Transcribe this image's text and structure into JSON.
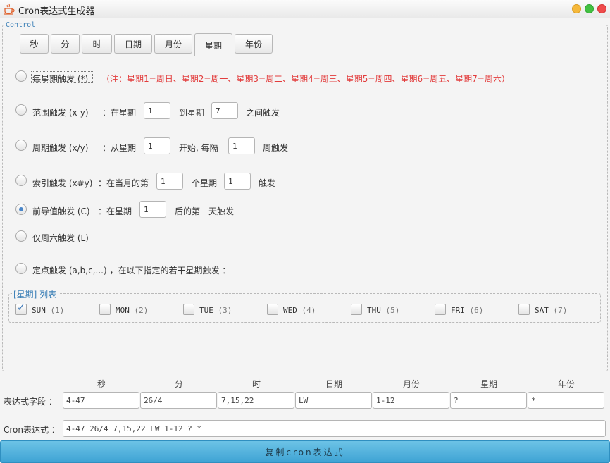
{
  "window": {
    "title": "Cron表达式生成器"
  },
  "control": {
    "legend": "Control"
  },
  "tabs": [
    {
      "label": "秒"
    },
    {
      "label": "分"
    },
    {
      "label": "时"
    },
    {
      "label": "日期"
    },
    {
      "label": "月份"
    },
    {
      "label": "星期",
      "active": true
    },
    {
      "label": "年份"
    }
  ],
  "options": {
    "every": {
      "label": "每星期触发 (*)",
      "note": "（注：星期1=周日、星期2=周一、星期3=周二、星期4=周三、星期5=周四、星期6=周五、星期7=周六）"
    },
    "range": {
      "label": "范围触发 (x-y)",
      "text1": "：在星期",
      "from": "1",
      "text2": "到星期",
      "to": "7",
      "text3": "之间触发"
    },
    "cycle": {
      "label": "周期触发 (x/y)",
      "text1": "：从星期",
      "start": "1",
      "text2": "开始, 每隔",
      "interval": "1",
      "text3": "周触发"
    },
    "index": {
      "label": "索引触发 (x#y)",
      "text1": "：在当月的第",
      "week": "1",
      "text2": "个星期",
      "day": "1",
      "text3": "触发"
    },
    "last": {
      "label": "前导值触发 (C)",
      "text1": "：在星期",
      "value": "1",
      "text2": "后的第一天触发",
      "selected": true
    },
    "sat": {
      "label": "仅周六触发 (L)"
    },
    "fixed": {
      "label": "定点触发 (a,b,c,...) ，在以下指定的若干星期触发 ："
    }
  },
  "weekdays": {
    "legend": "[星期] 列表",
    "items": [
      {
        "code": "SUN",
        "num": "(1)",
        "checked": true
      },
      {
        "code": "MON",
        "num": "(2)",
        "checked": false
      },
      {
        "code": "TUE",
        "num": "(3)",
        "checked": false
      },
      {
        "code": "WED",
        "num": "(4)",
        "checked": false
      },
      {
        "code": "THU",
        "num": "(5)",
        "checked": false
      },
      {
        "code": "FRI",
        "num": "(6)",
        "checked": false
      },
      {
        "code": "SAT",
        "num": "(7)",
        "checked": false
      }
    ]
  },
  "fields": {
    "headers": [
      "秒",
      "分",
      "时",
      "日期",
      "月份",
      "星期",
      "年份"
    ],
    "row_label": "表达式字段 ：",
    "values": [
      "4-47",
      "26/4",
      "7,15,22",
      "LW",
      "1-12",
      "?",
      "*"
    ]
  },
  "cron": {
    "label": "Cron表达式 ：",
    "value": "4-47 26/4 7,15,22 LW 1-12 ? *"
  },
  "copy_button": {
    "label": "复制cron表达式"
  }
}
